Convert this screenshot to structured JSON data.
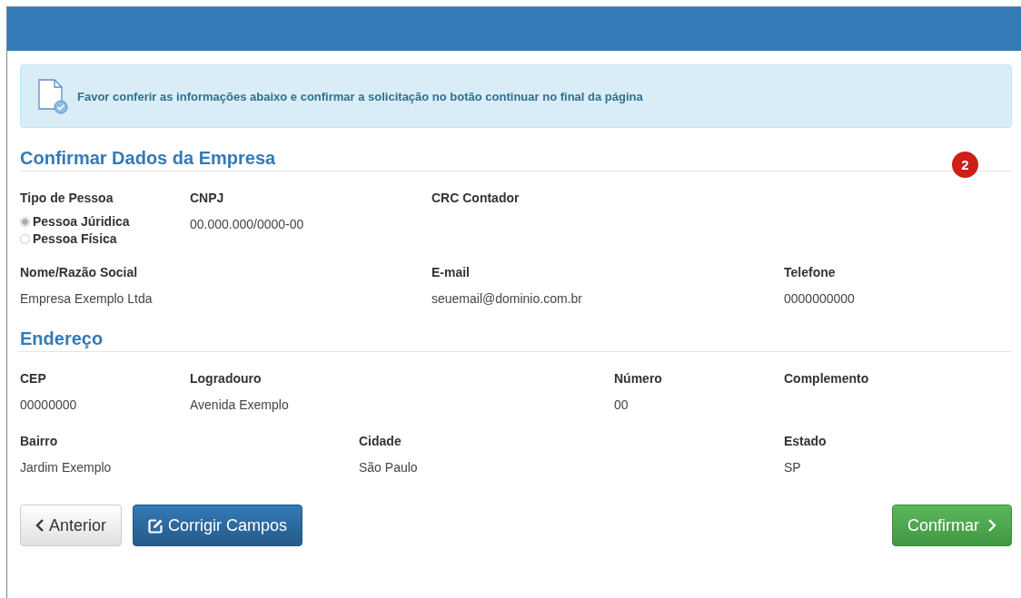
{
  "alert": {
    "text": "Favor conferir as informações abaixo e confirmar a solicitação no botão continuar no final da página"
  },
  "sections": [
    {
      "title": "Confirmar Dados da Empresa",
      "badge": "2",
      "rows": [
        [
          {
            "label": "Tipo de Pessoa",
            "kind": "radio",
            "options": [
              {
                "label": "Pessoa Júridica",
                "selected": true
              },
              {
                "label": "Pessoa Física",
                "selected": false
              }
            ]
          },
          {
            "label": "CNPJ",
            "kind": "text",
            "value": "00.000.000/0000-00"
          },
          {
            "label": "CRC Contador",
            "kind": "text"
          },
          ""
        ],
        [
          {
            "label": "Nome/Razão Social",
            "kind": "text",
            "value": "Empresa Exemplo Ltda"
          },
          "",
          {
            "label": "E-mail",
            "kind": "text",
            "value": "seuemail@dominio.com.br"
          },
          {
            "label": "Telefone",
            "kind": "text",
            "value": "0000000000"
          }
        ]
      ]
    },
    {
      "title": "Endereço",
      "rows": [
        [
          {
            "label": "CEP",
            "kind": "text",
            "value": "00000000"
          },
          {
            "label": "Logradouro",
            "kind": "text",
            "value": "Avenida Exemplo"
          },
          "",
          {
            "label": "Número",
            "kind": "text",
            "value": "00"
          },
          {
            "label": "Complemento",
            "kind": "text"
          }
        ],
        [
          {
            "label": "Bairro",
            "kind": "text",
            "value": "Jardim Exemplo"
          },
          "",
          {
            "label": "Cidade",
            "kind": "text",
            "value": "São Paulo"
          },
          "",
          {
            "label": "Estado",
            "kind": "text",
            "value": "SP"
          }
        ]
      ]
    }
  ],
  "buttons": [
    {
      "label": "Anterior",
      "kind": "back"
    },
    {
      "label": "Corrigir Campos",
      "kind": "edit"
    },
    {
      "label": "Confirmar",
      "kind": "confirm"
    }
  ]
}
